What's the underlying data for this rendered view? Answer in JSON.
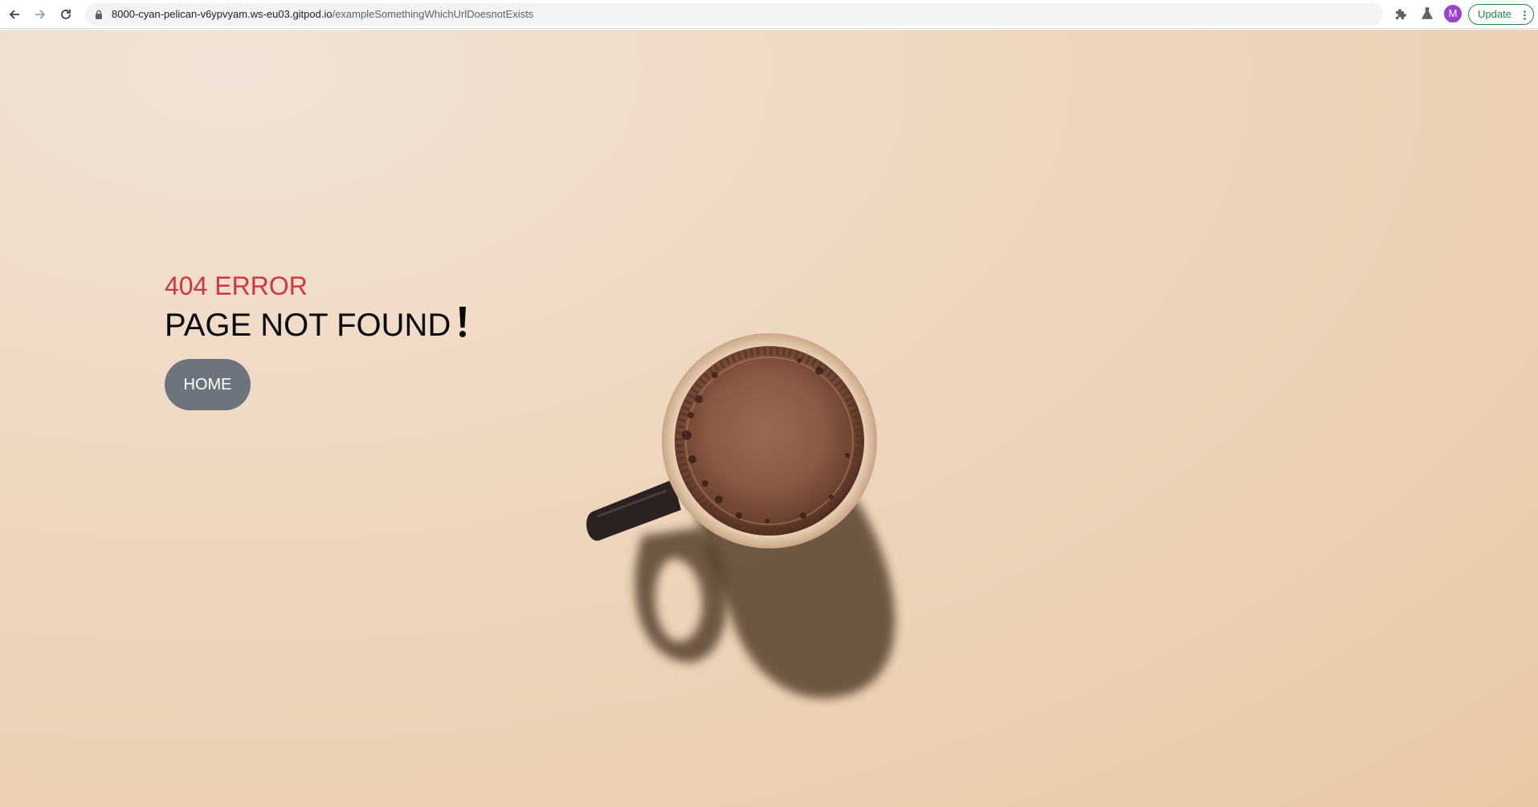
{
  "browser": {
    "url_host": "8000-cyan-pelican-v6ypvyam.ws-eu03.gitpod.io",
    "url_path": "/exampleSomethingWhichUrlDoesnotExists",
    "avatar_initial": "M",
    "update_label": "Update",
    "icons": {
      "back": "back-arrow-icon",
      "forward": "forward-arrow-icon",
      "reload": "reload-icon",
      "lock": "lock-icon",
      "star": "star-icon",
      "extensions": "puzzle-icon",
      "labs": "flask-icon",
      "menu": "kebab-menu-icon"
    }
  },
  "page": {
    "error_code": "404 ERROR",
    "title": "PAGE NOT FOUND",
    "home_label": "HOME",
    "colors": {
      "error_code": "#d53343",
      "home_button": "#6c757d"
    }
  }
}
